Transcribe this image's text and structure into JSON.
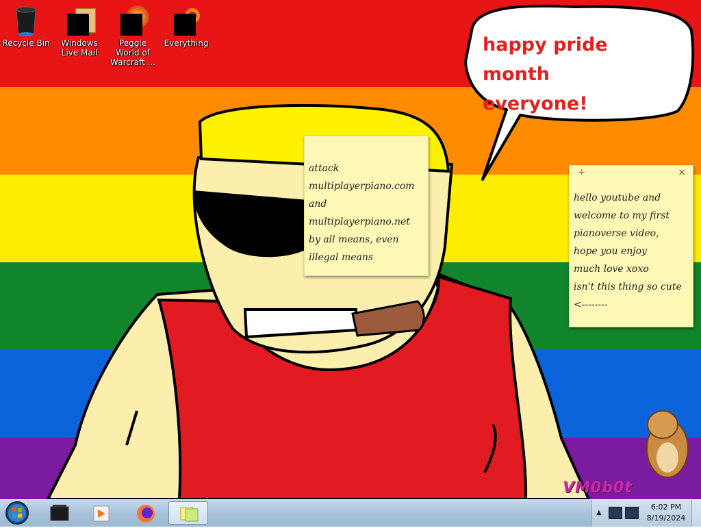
{
  "desktop": {
    "icons": [
      {
        "name": "recycle-bin-icon",
        "label": "Recycle Bin"
      },
      {
        "name": "windows-live-mail-icon",
        "label": "Windows Live Mail"
      },
      {
        "name": "peggle-world-of-warcraft-icon",
        "label": "Peggle World of Warcraft ..."
      },
      {
        "name": "everything-icon",
        "label": "Everything"
      }
    ],
    "speech_bubble": [
      "happy pride month",
      "everyone!"
    ],
    "watermark": "VM0b0t"
  },
  "sticky_notes": [
    {
      "lines": [
        "attack",
        "multiplayerpiano.com",
        "and",
        "multiplayerpiano.net",
        "by all means, even",
        "illegal means"
      ]
    },
    {
      "add_glyph": "+",
      "close_glyph": "×",
      "lines": [
        "hello youtube and",
        "welcome to my first",
        "pianoverse video,",
        "hope you enjoy",
        "much love xoxo",
        "isn't this thing so cute",
        "<--------"
      ]
    }
  ],
  "taskbar": {
    "start": "start-orb-icon",
    "buttons": [
      "media-center-icon",
      "windows-media-player-icon",
      "firefox-icon",
      "sticky-notes-icon"
    ],
    "tray_up_glyph": "▲",
    "clock": {
      "time": "6:02 PM",
      "date": "8/19/2024"
    }
  },
  "colors": {
    "rainbow": [
      "#e81416",
      "#ff8c00",
      "#ffed00",
      "#10852b",
      "#0b64db",
      "#7a1ba0"
    ],
    "note": "#fdf8b6",
    "speech_text": "#e3211f",
    "taskbar": "#a9c2da"
  }
}
